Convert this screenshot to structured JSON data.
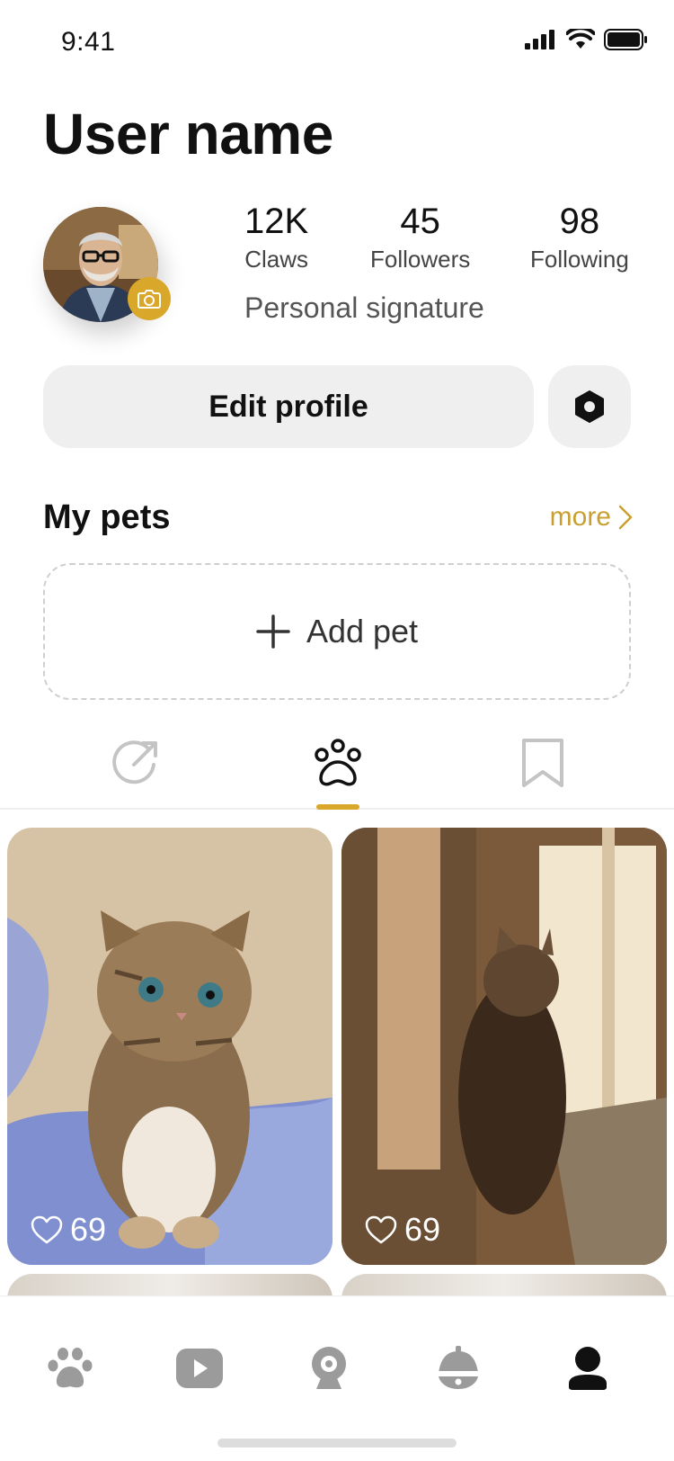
{
  "status_bar": {
    "time": "9:41"
  },
  "profile": {
    "user_name": "User name",
    "signature": "Personal signature",
    "stats": [
      {
        "value": "12K",
        "label": "Claws"
      },
      {
        "value": "45",
        "label": "Followers"
      },
      {
        "value": "98",
        "label": "Following"
      }
    ]
  },
  "actions": {
    "edit_profile": "Edit profile"
  },
  "pets": {
    "title": "My pets",
    "more": "more",
    "add_pet": "Add pet"
  },
  "content_tabs": [
    {
      "icon": "share-arrow-icon",
      "active": false
    },
    {
      "icon": "paw-icon",
      "active": true
    },
    {
      "icon": "bookmark-icon",
      "active": false
    }
  ],
  "feed": [
    {
      "image": "kitten-on-blanket-photo",
      "likes": "69"
    },
    {
      "image": "cat-by-window-photo",
      "likes": "69"
    }
  ],
  "bottom_nav": [
    {
      "icon": "paw-icon",
      "active": false
    },
    {
      "icon": "play-icon",
      "active": false
    },
    {
      "icon": "camera-device-icon",
      "active": false
    },
    {
      "icon": "bell-icon",
      "active": false
    },
    {
      "icon": "profile-icon",
      "active": true
    }
  ],
  "colors": {
    "accent": "#d9a72a",
    "more_link": "#c9a030",
    "button_bg": "#efefef",
    "inactive_icon": "#9b9b9b"
  }
}
